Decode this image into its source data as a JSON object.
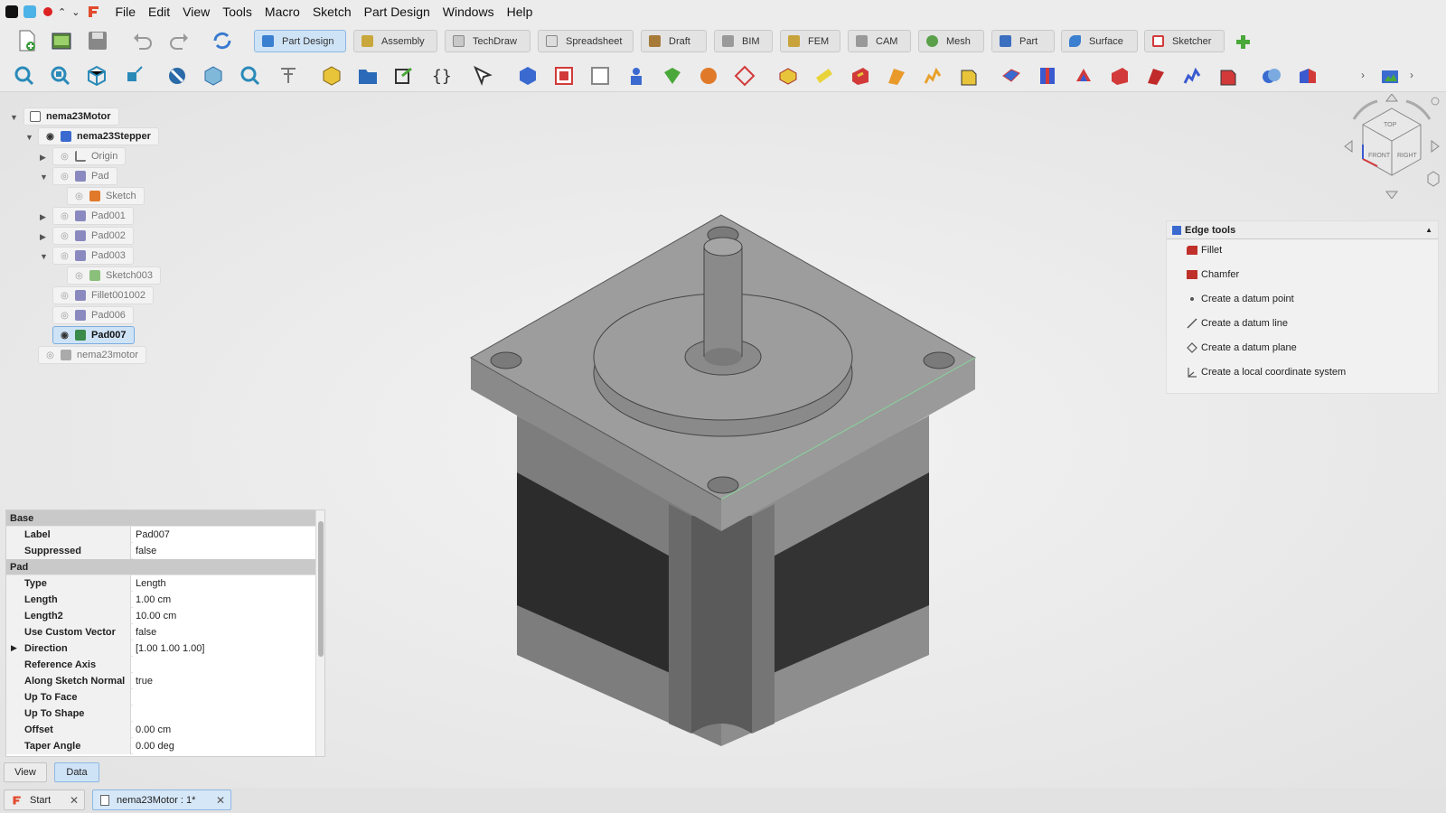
{
  "menubar": {
    "items": [
      "File",
      "Edit",
      "View",
      "Tools",
      "Macro",
      "Sketch",
      "Part Design",
      "Windows",
      "Help"
    ]
  },
  "workbenches": [
    {
      "label": "Part Design",
      "color": "#3b7fd0",
      "active": true
    },
    {
      "label": "Assembly",
      "color": "#c9a73a"
    },
    {
      "label": "TechDraw",
      "color": "#888888"
    },
    {
      "label": "Spreadsheet",
      "color": "#9a9a9a"
    },
    {
      "label": "Draft",
      "color": "#a77a3a"
    },
    {
      "label": "BIM",
      "color": "#8a8a8a"
    },
    {
      "label": "FEM",
      "color": "#c8a23a"
    },
    {
      "label": "CAM",
      "color": "#999999"
    },
    {
      "label": "Mesh",
      "color": "#5aa04a"
    },
    {
      "label": "Part",
      "color": "#3b6fc0"
    },
    {
      "label": "Surface",
      "color": "#3b7fd0"
    },
    {
      "label": "Sketcher",
      "color": "#d23a3a"
    }
  ],
  "tree": {
    "root": "nema23Motor",
    "body": "nema23Stepper",
    "items": {
      "origin": "Origin",
      "pad": "Pad",
      "sketch": "Sketch",
      "pad001": "Pad001",
      "pad002": "Pad002",
      "pad003": "Pad003",
      "sketch003": "Sketch003",
      "fillet": "Fillet001002",
      "pad006": "Pad006",
      "pad007": "Pad007",
      "nema23motor": "nema23motor"
    }
  },
  "properties": {
    "group_base": "Base",
    "label_key": "Label",
    "label_val": "Pad007",
    "suppressed_key": "Suppressed",
    "suppressed_val": "false",
    "group_pad": "Pad",
    "type_key": "Type",
    "type_val": "Length",
    "length_key": "Length",
    "length_val": "1.00 cm",
    "length2_key": "Length2",
    "length2_val": "10.00 cm",
    "ucv_key": "Use Custom Vector",
    "ucv_val": "false",
    "dir_key": "Direction",
    "dir_val": "[1.00 1.00 1.00]",
    "ref_key": "Reference Axis",
    "ref_val": "",
    "asn_key": "Along Sketch Normal",
    "asn_val": "true",
    "utf_key": "Up To Face",
    "utf_val": "",
    "uts_key": "Up To Shape",
    "uts_val": "",
    "offset_key": "Offset",
    "offset_val": "0.00 cm",
    "taper_key": "Taper Angle",
    "taper_val": "0.00 deg"
  },
  "bottom_tabs": {
    "view": "View",
    "data": "Data"
  },
  "doc_tabs": {
    "start": "Start",
    "doc": "nema23Motor : 1*"
  },
  "edge_tools": {
    "title": "Edge tools",
    "items": [
      "Fillet",
      "Chamfer",
      "Create a datum point",
      "Create a datum line",
      "Create a datum plane",
      "Create a local coordinate system"
    ]
  },
  "navcube": {
    "top": "TOP",
    "front": "FRONT",
    "right": "RIGHT"
  }
}
